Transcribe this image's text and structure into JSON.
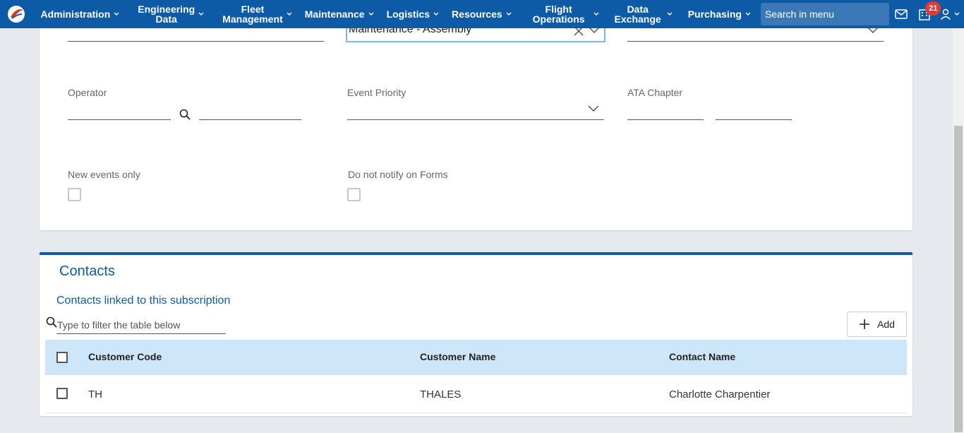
{
  "nav": {
    "items": [
      {
        "label": "Administration"
      },
      {
        "label": "Engineering\nData"
      },
      {
        "label": "Fleet\nManagement"
      },
      {
        "label": "Maintenance"
      },
      {
        "label": "Logistics"
      },
      {
        "label": "Resources"
      },
      {
        "label": "Flight\nOperations"
      },
      {
        "label": "Data\nExchange"
      },
      {
        "label": "Purchasing"
      }
    ],
    "search_placeholder": "Search in menu",
    "notification_count": "21",
    "icons": [
      "app-logo-icon",
      "mail-icon",
      "building-icon",
      "user-icon"
    ]
  },
  "form": {
    "event_type_value": "Maintenance - Assembly",
    "operator_label": "Operator",
    "event_priority_label": "Event Priority",
    "ata_chapter_label": "ATA Chapter",
    "new_events_label": "New events only",
    "do_not_notify_label": "Do not notify on Forms"
  },
  "contacts": {
    "title": "Contacts",
    "subtitle": "Contacts linked to this subscription",
    "filter_placeholder": "Type to filter the table below",
    "add_label": "Add",
    "columns": [
      "Customer Code",
      "Customer Name",
      "Contact Name"
    ],
    "rows": [
      {
        "code": "TH",
        "name": "THALES",
        "contact": "Charlotte Charpentier"
      }
    ]
  },
  "colors": {
    "nav_bg": "#0d5aa7",
    "accent": "#0d5aa7",
    "table_header_bg": "#cde6fa",
    "badge": "#e53935"
  }
}
